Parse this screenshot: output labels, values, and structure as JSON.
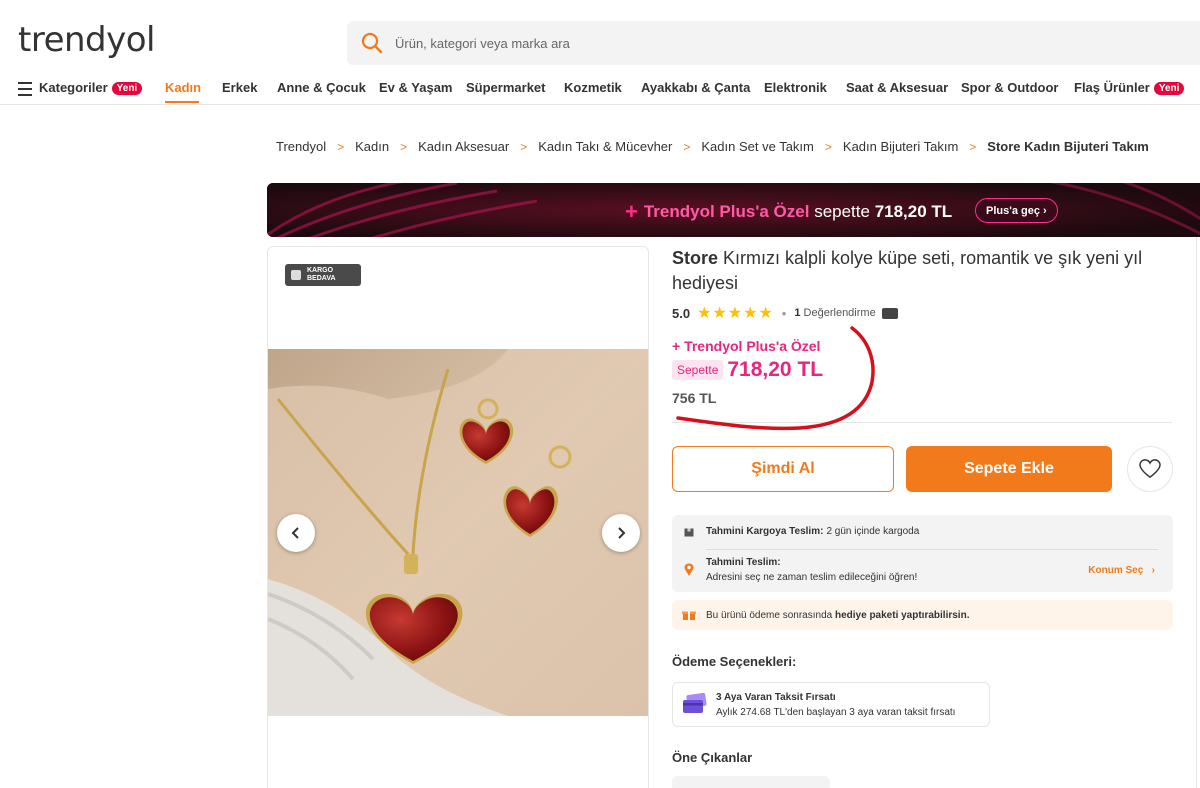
{
  "header": {
    "logo": "trendyol",
    "search_placeholder": "Ürün, kategori veya marka ara"
  },
  "nav": {
    "categories_label": "Kategoriler",
    "new_badge": "Yeni",
    "items": [
      "Kadın",
      "Erkek",
      "Anne & Çocuk",
      "Ev & Yaşam",
      "Süpermarket",
      "Kozmetik",
      "Ayakkabı & Çanta",
      "Elektronik",
      "Saat & Aksesuar",
      "Spor & Outdoor"
    ],
    "flash_label": "Flaş Ürünler",
    "flash_badge": "Yeni",
    "active": "Kadın"
  },
  "breadcrumb": [
    "Trendyol",
    "Kadın",
    "Kadın Aksesuar",
    "Kadın Takı & Mücevher",
    "Kadın Set ve Takım",
    "Kadın Bijuteri Takım",
    "Store Kadın Bijuteri Takım"
  ],
  "banner": {
    "plus_title": "Trendyol Plus'a Özel",
    "sepette": "sepette",
    "price": "718,20 TL",
    "button": "Plus'a geç"
  },
  "gallery": {
    "badge_line1": "KARGO",
    "badge_line2": "BEDAVA"
  },
  "product": {
    "brand": "Store",
    "title": "Kırmızı kalpli kolye küpe seti, romantik ve şık yeni yıl hediyesi",
    "rating": "5.0",
    "stars": 5,
    "review_count": "1",
    "review_label": "Değerlendirme",
    "plus_label": "Trendyol Plus'a Özel",
    "sepette_tag": "Sepette",
    "plus_price": "718,20 TL",
    "price": "756 TL",
    "buy_now": "Şimdi Al",
    "add_to_cart": "Sepete Ekle"
  },
  "delivery": {
    "cargo_label": "Tahmini Kargoya Teslim:",
    "cargo_value": "2 gün içinde kargoda",
    "eta_label": "Tahmini Teslim:",
    "eta_desc": "Adresini seç ne zaman teslim edileceğini öğren!",
    "location_link": "Konum Seç"
  },
  "gift": {
    "text_prefix": "Bu ürünü ödeme sonrasında",
    "text_bold": "hediye paketi yaptırabilirsin."
  },
  "payment": {
    "heading": "Ödeme Seçenekleri:",
    "title": "3 Aya Varan Taksit Fırsatı",
    "desc": "Aylık 274.68 TL'den başlayan 3 aya varan taksit fırsatı"
  },
  "highlights": {
    "heading": "Öne Çıkanlar"
  },
  "colors": {
    "accent": "#f27a1a",
    "plus_pink": "#e8257f",
    "star": "#ffc000",
    "annotation_red": "#d4111a"
  }
}
